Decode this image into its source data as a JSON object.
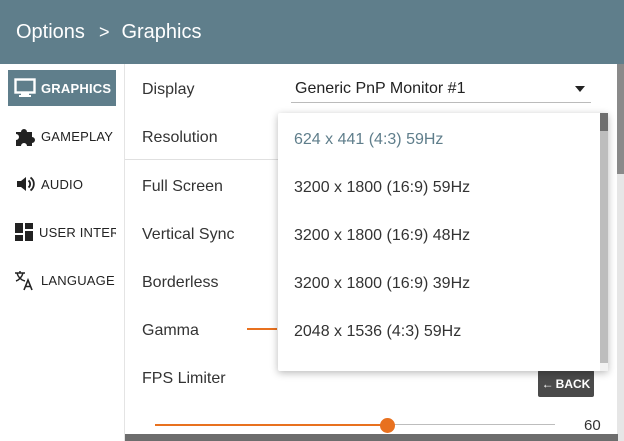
{
  "header": {
    "crumb_options": "Options",
    "separator": ">",
    "crumb_graphics": "Graphics",
    "color": "#5f7e8b"
  },
  "sidebar": {
    "items": [
      {
        "label": "GRAPHICS",
        "icon": "monitor-icon",
        "active": true
      },
      {
        "label": "GAMEPLAY",
        "icon": "puzzle-icon",
        "active": false
      },
      {
        "label": "AUDIO",
        "icon": "speaker-icon",
        "active": false
      },
      {
        "label": "USER INTERFACE",
        "icon": "dashboard-icon",
        "active": false
      },
      {
        "label": "LANGUAGE",
        "icon": "translate-icon",
        "active": false
      }
    ]
  },
  "settings": {
    "display_label": "Display",
    "display_value": "Generic PnP Monitor #1",
    "resolution_label": "Resolution",
    "fullscreen_label": "Full Screen",
    "vsync_label": "Vertical Sync",
    "borderless_label": "Borderless",
    "gamma_label": "Gamma",
    "fps_label": "FPS Limiter",
    "fps_value": "60",
    "fps_fraction": 0.58
  },
  "back_button": {
    "arrow": "←",
    "label": "BACK"
  },
  "resolution_dropdown": {
    "options": [
      "624 x 441 (4:3) 59Hz",
      "3200 x 1800 (16:9) 59Hz",
      "3200 x 1800 (16:9) 48Hz",
      "3200 x 1800 (16:9) 39Hz",
      "2048 x 1536 (4:3) 59Hz"
    ],
    "selected_index": 0
  },
  "colors": {
    "accent": "#e8711f",
    "primary": "#5f7e8b",
    "back_button": "#4a4a4a"
  }
}
